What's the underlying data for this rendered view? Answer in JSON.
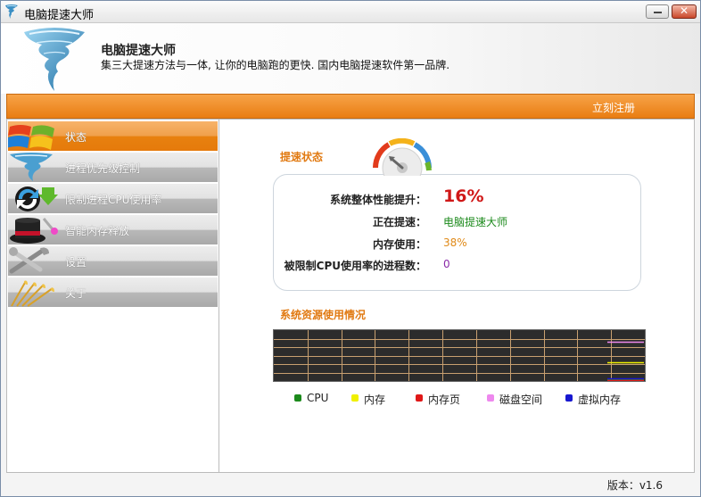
{
  "window": {
    "title": "电脑提速大师"
  },
  "header": {
    "app_name": "电脑提速大师",
    "tagline": "集三大提速方法与一体, 让你的电脑跑的更快. 国内电脑提速软件第一品牌."
  },
  "toolbar": {
    "register_label": "立刻注册"
  },
  "sidebar": {
    "items": [
      {
        "label": "状态",
        "icon": "windows-logo-icon",
        "active": true
      },
      {
        "label": "进程优先级控制",
        "icon": "tornado-icon",
        "active": false
      },
      {
        "label": "限制进程CPU使用率",
        "icon": "refresh-arrows-icon",
        "active": false
      },
      {
        "label": "智能内存释放",
        "icon": "magic-hat-icon",
        "active": false
      },
      {
        "label": "设置",
        "icon": "tools-icon",
        "active": false
      },
      {
        "label": "关于",
        "icon": "wheat-icon",
        "active": false
      }
    ]
  },
  "status": {
    "section_title": "提速状态",
    "rows": [
      {
        "label": "系统整体性能提升：",
        "value": "16%"
      },
      {
        "label": "正在提速：",
        "value": "电脑提速大师"
      },
      {
        "label": "内存使用：",
        "value": "38%"
      },
      {
        "label": "被限制CPU使用率的进程数：",
        "value": "0"
      }
    ]
  },
  "resources": {
    "section_title": "系统资源使用情况",
    "legend": [
      {
        "label": "CPU",
        "color": "#1c8a1c"
      },
      {
        "label": "内存",
        "color": "#f0f000"
      },
      {
        "label": "内存页",
        "color": "#e01818"
      },
      {
        "label": "磁盘空间",
        "color": "#ee88ee"
      },
      {
        "label": "虚拟内存",
        "color": "#1818d0"
      }
    ]
  },
  "footer": {
    "version": "版本：v1.6"
  },
  "colors": {
    "accent": "#e97d12",
    "grid_line": "#c8a070"
  }
}
